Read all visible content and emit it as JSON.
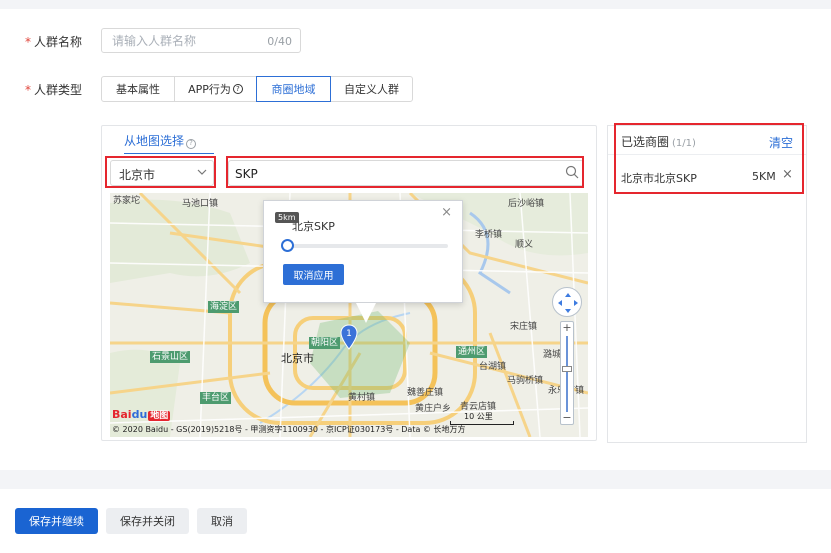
{
  "form": {
    "name_label": "人群名称",
    "name_placeholder": "请输入人群名称",
    "name_count": "0/40",
    "type_label": "人群类型",
    "required_mark": "*"
  },
  "type_tabs": [
    {
      "label": "基本属性",
      "active": false
    },
    {
      "label": "APP行为",
      "active": false,
      "help": "?"
    },
    {
      "label": "商圈地域",
      "active": true
    },
    {
      "label": "自定义人群",
      "active": false
    }
  ],
  "map_panel": {
    "tab_label": "从地图选择",
    "tab_help": "?",
    "city_value": "北京市",
    "search_value": "SKP"
  },
  "map": {
    "labels": [
      {
        "text": "苏家坨",
        "kind": "town"
      },
      {
        "text": "马池口镇",
        "kind": "town"
      },
      {
        "text": "后沙峪镇",
        "kind": "town"
      },
      {
        "text": "李桥镇",
        "kind": "town"
      },
      {
        "text": "顺义",
        "kind": "town"
      },
      {
        "text": "宋庄镇",
        "kind": "town"
      },
      {
        "text": "潞城镇",
        "kind": "town"
      },
      {
        "text": "台湖镇",
        "kind": "town"
      },
      {
        "text": "马驹桥镇",
        "kind": "town"
      },
      {
        "text": "永乐店镇",
        "kind": "town"
      },
      {
        "text": "黄村镇",
        "kind": "town"
      },
      {
        "text": "魏善庄镇",
        "kind": "town"
      },
      {
        "text": "青云店镇",
        "kind": "town"
      },
      {
        "text": "黄庄户乡",
        "kind": "town"
      },
      {
        "text": "北京市",
        "kind": "city"
      }
    ],
    "districts": [
      {
        "text": "海淀区"
      },
      {
        "text": "朝阳区"
      },
      {
        "text": "石景山区"
      },
      {
        "text": "丰台区"
      },
      {
        "text": "通州区"
      }
    ],
    "copyright": "© 2020 Baidu - GS(2019)5218号 - 甲测资字1100930 - 京ICP证030173号 - Data © 长地万方",
    "logo_text": "Bai",
    "logo_paw": "du",
    "logo_map": "地图",
    "scale_label": "10 公里",
    "marker_number": "1",
    "zoom_plus": "+",
    "zoom_minus": "−"
  },
  "popup": {
    "title": "北京SKP",
    "tooltip": "5km",
    "radius_fraction": 0.0,
    "cancel_label": "取消应用",
    "close": "×"
  },
  "selected": {
    "title": "已选商圈",
    "count": "(1/1)",
    "clear_label": "清空",
    "items": [
      {
        "name": "北京市北京SKP",
        "radius": "5KM",
        "remove": "×"
      }
    ]
  },
  "footer": {
    "save_continue": "保存并继续",
    "save_close": "保存并关闭",
    "cancel": "取消"
  },
  "colors": {
    "accent": "#2d6fd6",
    "primary_button": "#1a64d2",
    "required": "#e0453b",
    "highlight_box": "#e5262e"
  }
}
